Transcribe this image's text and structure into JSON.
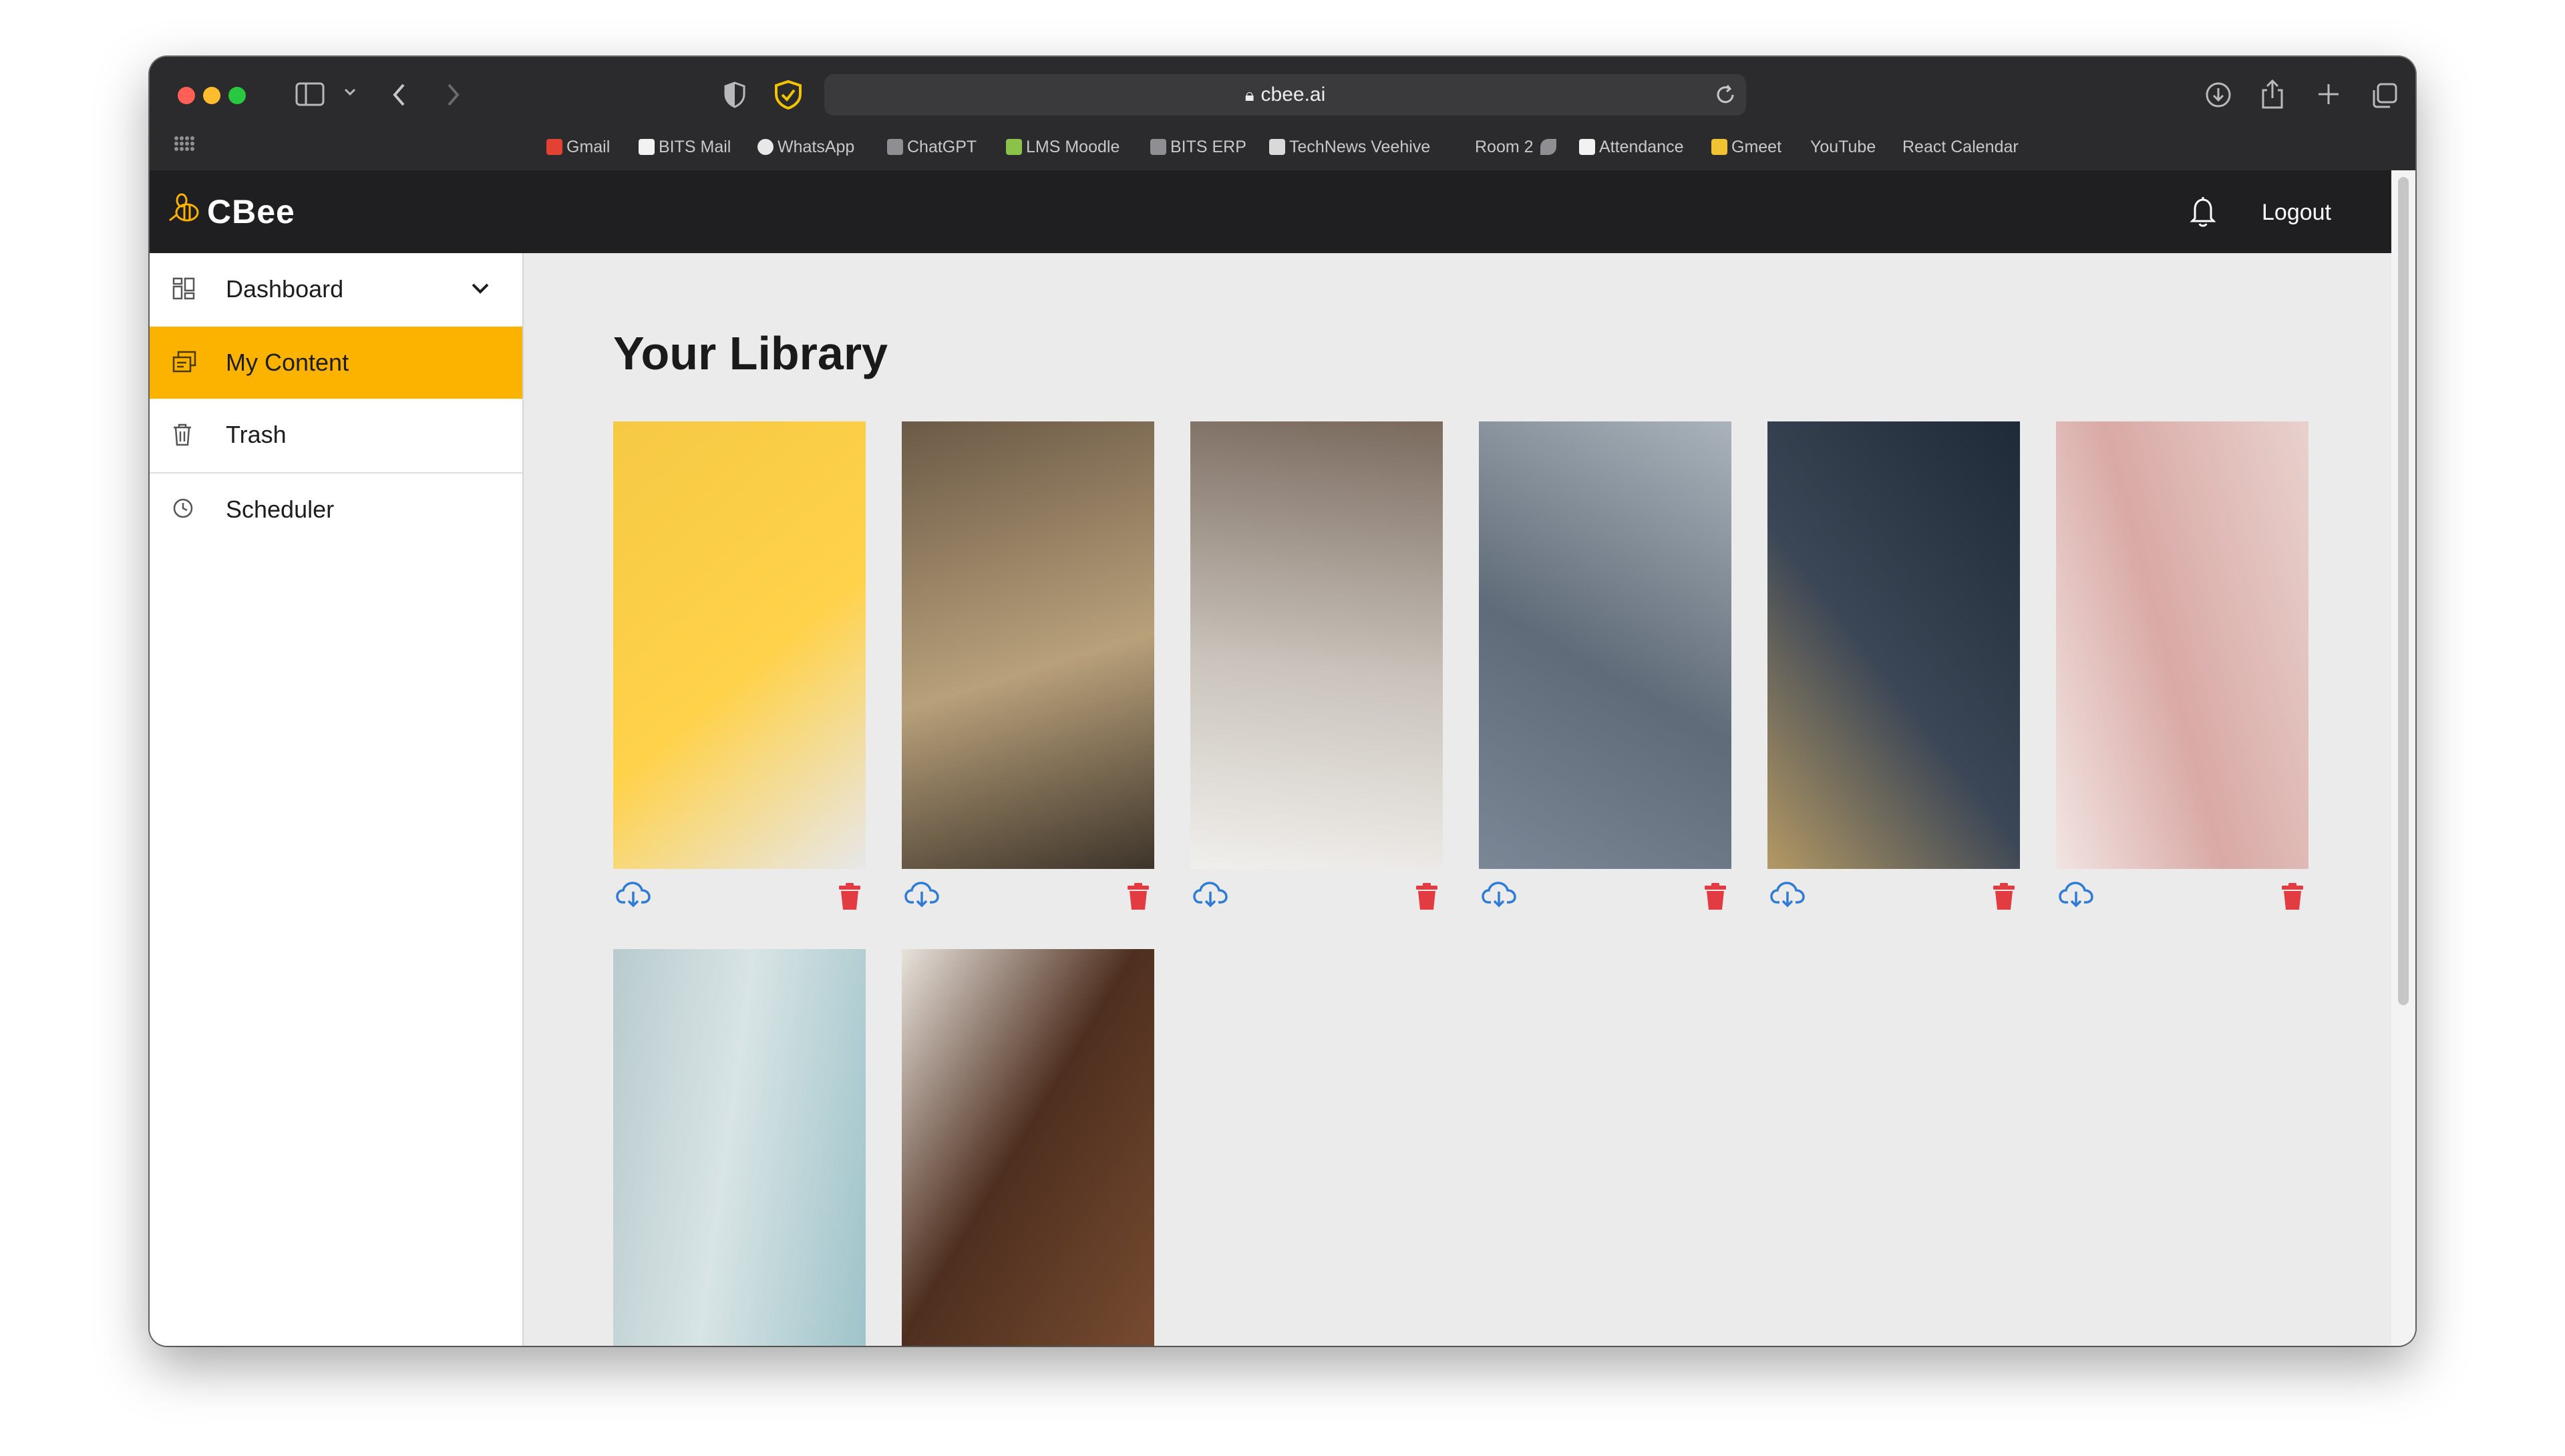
{
  "browser": {
    "url": "cbee.ai",
    "bookmarks": [
      "Gmail",
      "BITS Mail",
      "WhatsApp",
      "ChatGPT",
      "LMS Moodle",
      "BITS ERP",
      "TechNews Veehive",
      "Room 2",
      "Attendance",
      "Gmeet",
      "YouTube",
      "React Calendar"
    ]
  },
  "app": {
    "logo": "CBee",
    "logout_label": "Logout",
    "accent_color": "#fbb300",
    "sidebar": {
      "items": [
        {
          "label": "Dashboard",
          "icon": "grid-icon"
        },
        {
          "label": "My Content",
          "icon": "content-icon",
          "active": true
        },
        {
          "label": "Trash",
          "icon": "trash-icon"
        },
        {
          "label": "Scheduler",
          "icon": "clock-icon"
        }
      ]
    },
    "library": {
      "title": "Your Library",
      "items": [
        {
          "subject": "phone app illustration",
          "palette": [
            "#f6c944",
            "#ffd24a",
            "#e7e7ea"
          ]
        },
        {
          "subject": "board game on table",
          "palette": [
            "#6b5a47",
            "#b8a07a",
            "#3d342a"
          ]
        },
        {
          "subject": "woman in white shirt",
          "palette": [
            "#7a6a5e",
            "#c9c3bb",
            "#f1efec"
          ]
        },
        {
          "subject": "gloved hand with phone",
          "palette": [
            "#aab3bb",
            "#5f6b78",
            "#7b8796"
          ]
        },
        {
          "subject": "theater rehearsal",
          "palette": [
            "#1f2a38",
            "#3b4656",
            "#b49964"
          ]
        },
        {
          "subject": "pink blazer",
          "palette": [
            "#e8d1cd",
            "#d9a9a5",
            "#f1e4e2"
          ]
        },
        {
          "subject": "ocean wave",
          "palette": [
            "#9cc2c8",
            "#d8e4e5",
            "#b9cbce"
          ]
        },
        {
          "subject": "courtroom",
          "palette": [
            "#7b4e32",
            "#4e2f1f",
            "#e8e3dc"
          ]
        }
      ]
    }
  }
}
